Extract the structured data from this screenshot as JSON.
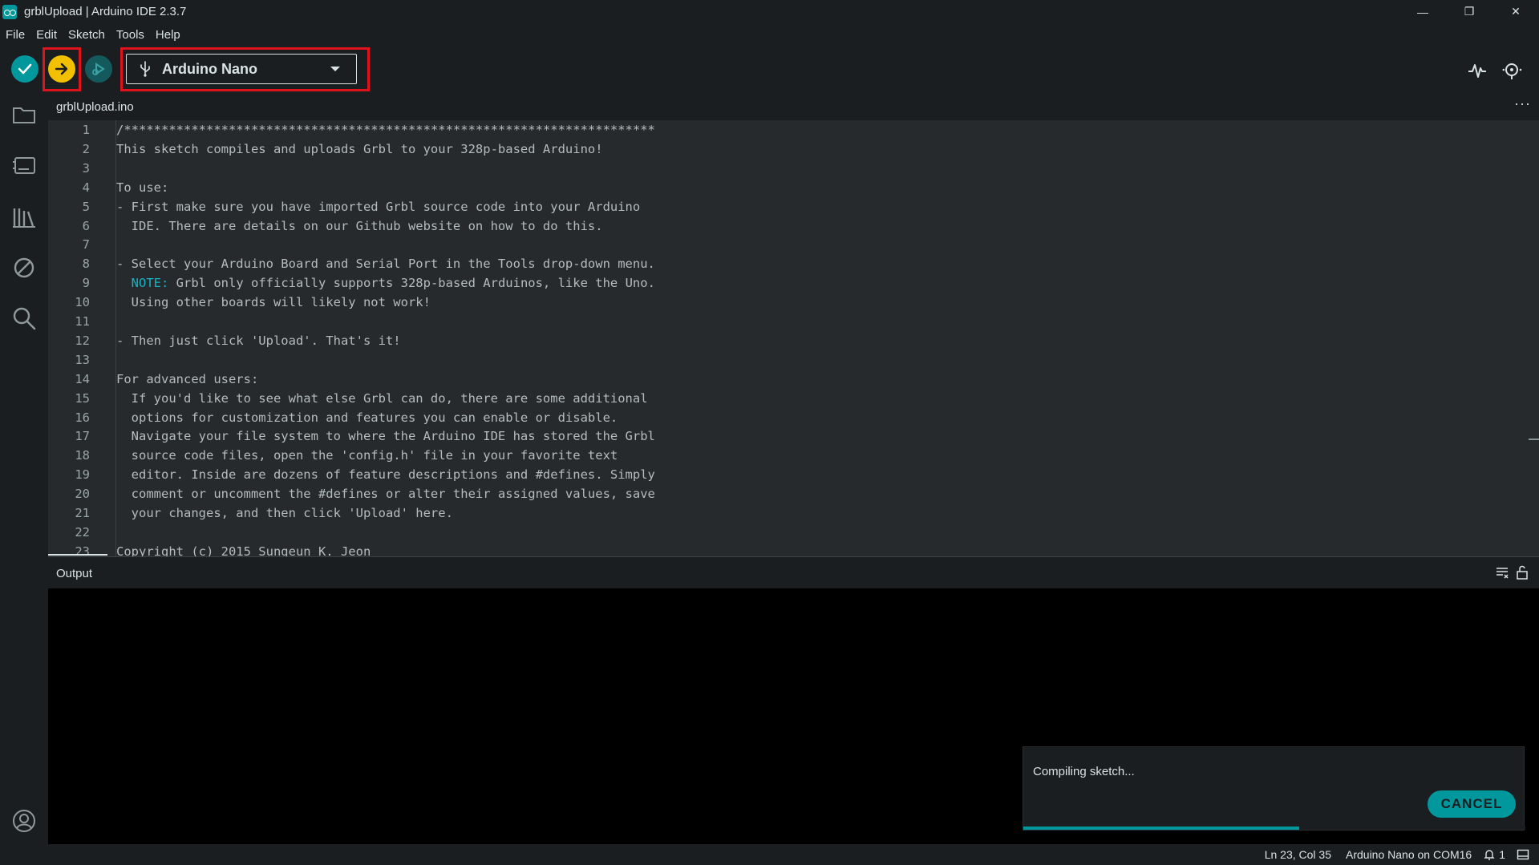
{
  "window": {
    "title": "grblUpload | Arduino IDE 2.3.7",
    "minimize": "—",
    "restore": "❐",
    "close": "✕"
  },
  "menu": [
    "File",
    "Edit",
    "Sketch",
    "Tools",
    "Help"
  ],
  "toolbar": {
    "board": "Arduino Nano",
    "highlighted": [
      "upload-button",
      "board-selector"
    ],
    "highlight_color": "#e0121c"
  },
  "tab": {
    "filename": "grblUpload.ino",
    "more": "···"
  },
  "editor": {
    "lines": [
      {
        "n": "1",
        "text": "/***********************************************************************"
      },
      {
        "n": "2",
        "text": "This sketch compiles and uploads Grbl to your 328p-based Arduino!"
      },
      {
        "n": "3",
        "text": ""
      },
      {
        "n": "4",
        "text": "To use:"
      },
      {
        "n": "5",
        "text": "- First make sure you have imported Grbl source code into your Arduino"
      },
      {
        "n": "6",
        "text": "  IDE. There are details on our Github website on how to do this."
      },
      {
        "n": "7",
        "text": ""
      },
      {
        "n": "8",
        "text": "- Select your Arduino Board and Serial Port in the Tools drop-down menu."
      },
      {
        "n": "9",
        "note": "NOTE:",
        "text": " Grbl only officially supports 328p-based Arduinos, like the Uno."
      },
      {
        "n": "10",
        "text": "  Using other boards will likely not work!"
      },
      {
        "n": "11",
        "text": ""
      },
      {
        "n": "12",
        "text": "- Then just click 'Upload'. That's it!"
      },
      {
        "n": "13",
        "text": ""
      },
      {
        "n": "14",
        "text": "For advanced users:"
      },
      {
        "n": "15",
        "text": "  If you'd like to see what else Grbl can do, there are some additional"
      },
      {
        "n": "16",
        "text": "  options for customization and features you can enable or disable."
      },
      {
        "n": "17",
        "text": "  Navigate your file system to where the Arduino IDE has stored the Grbl"
      },
      {
        "n": "18",
        "text": "  source code files, open the 'config.h' file in your favorite text"
      },
      {
        "n": "19",
        "text": "  editor. Inside are dozens of feature descriptions and #defines. Simply"
      },
      {
        "n": "20",
        "text": "  comment or uncomment the #defines or alter their assigned values, save"
      },
      {
        "n": "21",
        "text": "  your changes, and then click 'Upload' here."
      },
      {
        "n": "22",
        "text": ""
      },
      {
        "n": "23",
        "text": "Copyright (c) 2015 Sungeun K. Jeon"
      }
    ]
  },
  "output": {
    "title": "Output"
  },
  "notification": {
    "message": "Compiling sketch...",
    "cancel_label": "CANCEL",
    "progress": 0.55
  },
  "status": {
    "position": "Ln 23, Col 35",
    "board_port": "Arduino Nano on COM16",
    "notifications": "1"
  }
}
